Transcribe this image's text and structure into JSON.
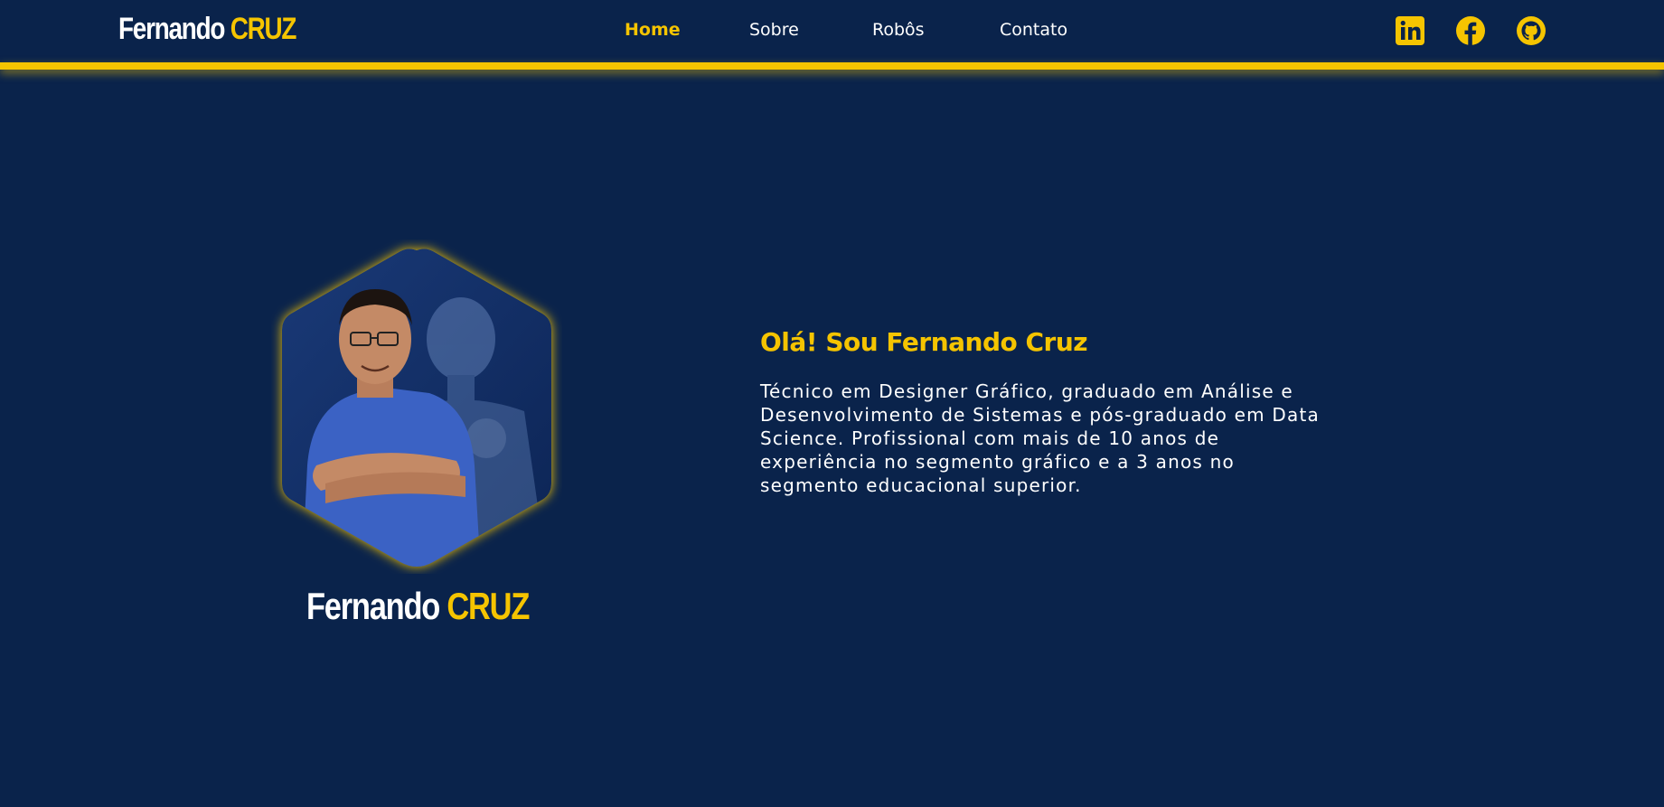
{
  "header": {
    "logo_first": "Fernando",
    "logo_second": "CRUZ"
  },
  "nav": {
    "items": [
      {
        "label": "Home",
        "active": true
      },
      {
        "label": "Sobre",
        "active": false
      },
      {
        "label": "Robôs",
        "active": false
      },
      {
        "label": "Contato",
        "active": false
      }
    ]
  },
  "social": [
    {
      "icon": "linkedin-icon"
    },
    {
      "icon": "facebook-icon"
    },
    {
      "icon": "github-icon"
    }
  ],
  "hero": {
    "name_first": "Fernando",
    "name_second": "CRUZ",
    "greeting": "Olá! Sou Fernando Cruz",
    "bio": "Técnico em Designer Gráfico, graduado em Análise e Desenvolvimento de Sistemas e pós-graduado em Data Science. Profissional com mais de 10 anos de experiência no segmento gráfico e a 3 anos no segmento educacional superior."
  },
  "colors": {
    "background": "#0a234b",
    "accent": "#f5c400",
    "text": "#ffffff"
  }
}
